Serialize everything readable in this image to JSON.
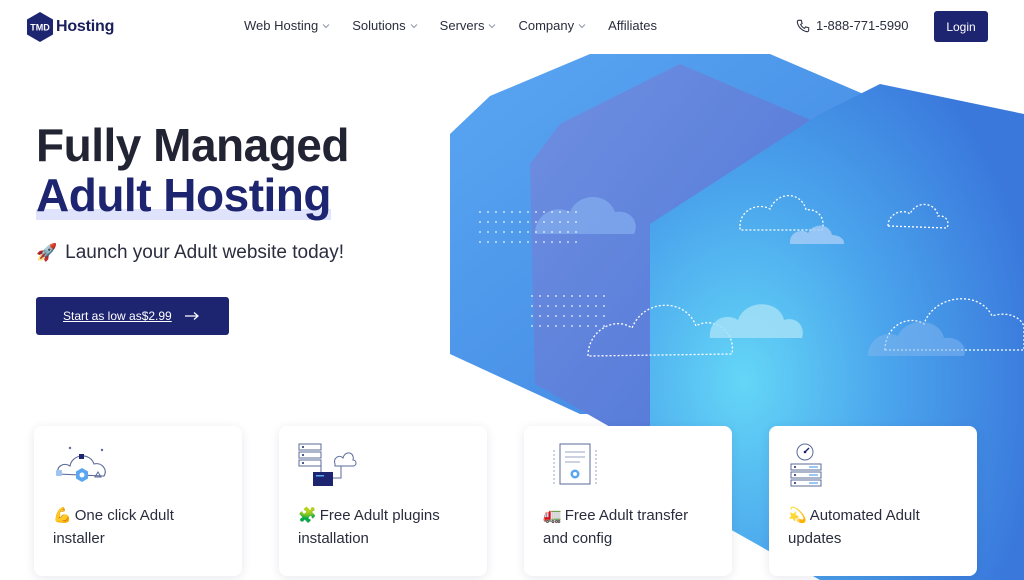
{
  "brand": {
    "logo_mark": "TMD",
    "logo_text": "Hosting"
  },
  "nav": {
    "items": [
      {
        "label": "Web Hosting",
        "has_dropdown": true
      },
      {
        "label": "Solutions",
        "has_dropdown": true
      },
      {
        "label": "Servers",
        "has_dropdown": true
      },
      {
        "label": "Company",
        "has_dropdown": true
      },
      {
        "label": "Affiliates",
        "has_dropdown": false
      }
    ],
    "phone": "1-888-771-5990",
    "login_label": "Login"
  },
  "hero": {
    "title_line1": "Fully Managed",
    "title_line2": "Adult Hosting",
    "tagline_emoji": "🚀",
    "tagline": "Launch your Adult website today!",
    "cta_label": "Start as low as$2.99"
  },
  "features": [
    {
      "emoji": "💪",
      "line1": "One click Adult",
      "line2": "installer",
      "icon": "cloud-network-icon"
    },
    {
      "emoji": "🧩",
      "line1": "Free Adult plugins",
      "line2": "installation",
      "icon": "server-monitor-icon"
    },
    {
      "emoji": "🚛",
      "line1": "Free Adult transfer",
      "line2": "and config",
      "icon": "certificate-document-icon"
    },
    {
      "emoji": "💫",
      "line1": "Automated Adult",
      "line2": "updates",
      "icon": "server-gauge-icon"
    }
  ],
  "colors": {
    "primary": "#1d2470",
    "hero_blue": "#3f8ee8",
    "text": "#222433"
  }
}
